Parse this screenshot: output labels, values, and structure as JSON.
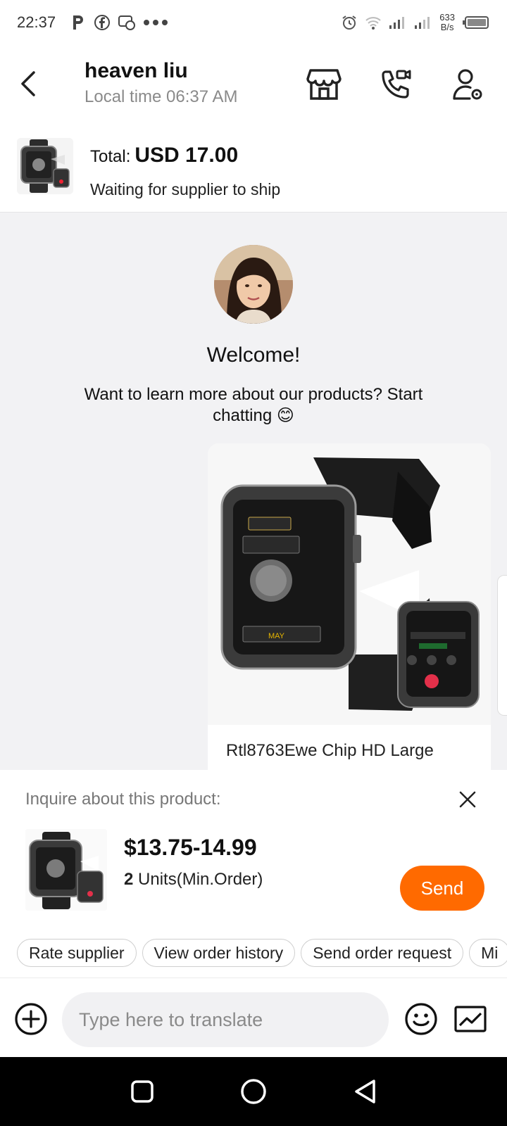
{
  "status_bar": {
    "time": "22:37",
    "net_speed_value": "633",
    "net_speed_unit": "B/s"
  },
  "header": {
    "name": "heaven liu",
    "local_time": "Local time 06:37 AM",
    "icons": [
      "back-icon",
      "store-icon",
      "video-call-icon",
      "profile-settings-icon"
    ]
  },
  "order": {
    "total_label": "Total:",
    "total_value": "USD 17.00",
    "status": "Waiting for supplier to ship"
  },
  "chat": {
    "welcome": "Welcome!",
    "welcome_sub": "Want to learn more about our products? Start chatting 😊",
    "product_name": "Rtl8763Ewe Chip HD Large"
  },
  "inquiry": {
    "label": "Inquire about this product:",
    "price": "$13.75-14.99",
    "min_qty": "2",
    "min_unit": "Units(Min.Order)",
    "send_label": "Send"
  },
  "quick_actions": [
    "Rate supplier",
    "View order history",
    "Send order request",
    "Mi"
  ],
  "input": {
    "placeholder": "Type here to translate"
  },
  "colors": {
    "accent": "#ff6a00",
    "chat_bg": "#f2f2f4"
  }
}
